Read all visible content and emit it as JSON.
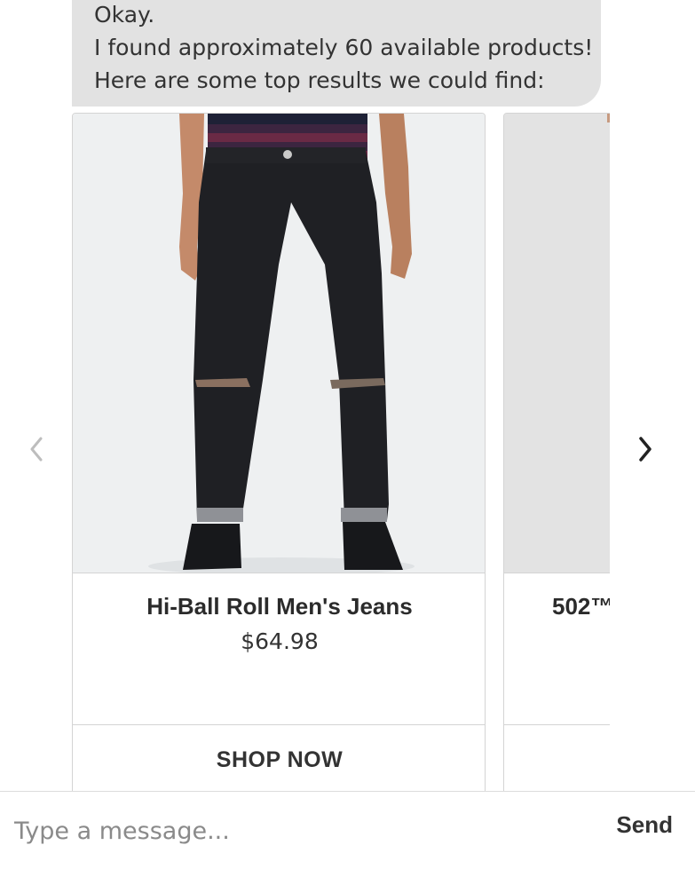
{
  "chat": {
    "message_lines": [
      "Okay.",
      "I found approximately 60 available products!",
      "Here are some top results we could find:"
    ]
  },
  "carousel": {
    "prev_icon": "chevron-left-icon",
    "next_icon": "chevron-right-icon",
    "cards": [
      {
        "title": "Hi-Ball Roll Men's Jeans",
        "price": "$64.98",
        "action_label": "SHOP NOW"
      },
      {
        "title": "502™",
        "price": "",
        "action_label": ""
      }
    ]
  },
  "composer": {
    "placeholder": "Type a message...",
    "send_label": "Send"
  },
  "colors": {
    "bubble": "#e2e2e2",
    "text": "#333333",
    "border": "#d4d4d4"
  }
}
